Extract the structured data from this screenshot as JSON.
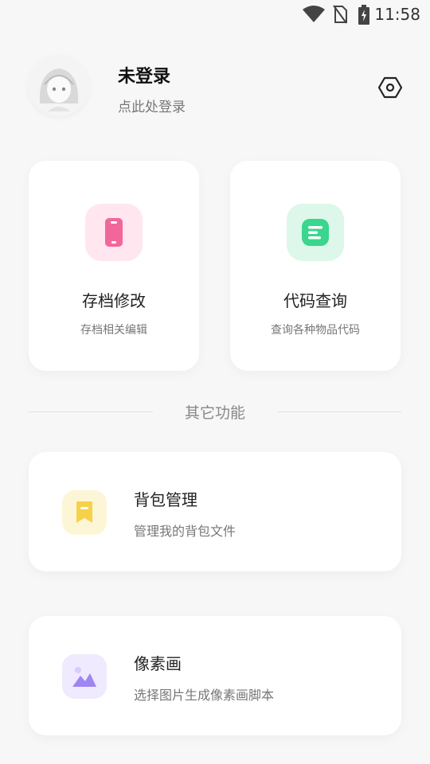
{
  "status_bar": {
    "time": "11:58",
    "icons": [
      "wifi-icon",
      "no-sim-icon",
      "battery-charging-icon"
    ]
  },
  "profile": {
    "username": "未登录",
    "login_hint": "点此处登录",
    "settings_icon": "settings-hex-icon"
  },
  "grid": [
    {
      "title": "存档修改",
      "subtitle": "存档相关编辑",
      "icon": "phone-icon",
      "color": "#f2679b",
      "bg": "#ffe6ef"
    },
    {
      "title": "代码查询",
      "subtitle": "查询各种物品代码",
      "icon": "list-icon",
      "color": "#3ad68d",
      "bg": "#ddf7ea"
    }
  ],
  "section": {
    "label": "其它功能"
  },
  "list": [
    {
      "title": "背包管理",
      "subtitle": "管理我的背包文件",
      "icon": "bookmark-icon",
      "color": "#f6d24a",
      "bg": "#fdf6d6"
    },
    {
      "title": "像素画",
      "subtitle": "选择图片生成像素画脚本",
      "icon": "image-icon",
      "color": "#9f85f3",
      "bg": "#efeafd"
    }
  ]
}
